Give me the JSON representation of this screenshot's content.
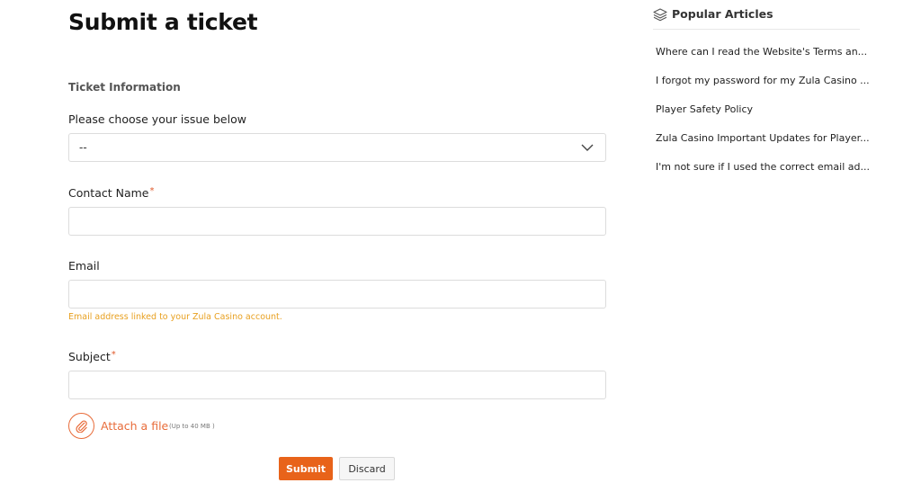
{
  "page": {
    "title": "Submit a ticket"
  },
  "form": {
    "section_title": "Ticket Information",
    "issue_label": "Please choose your issue below",
    "issue_value": "--",
    "contact_label": "Contact Name",
    "required_mark": "*",
    "email_label": "Email",
    "email_hint": "Email address linked to your Zula Casino account.",
    "subject_label": "Subject",
    "attach_label": "Attach a file",
    "attach_limit": "(Up to 40 MB )",
    "submit_label": "Submit",
    "discard_label": "Discard"
  },
  "sidebar": {
    "title": "Popular Articles",
    "articles": [
      "Where can I read the Website's Terms an...",
      "I forgot my password for my Zula Casino ...",
      "Player Safety Policy",
      "Zula Casino Important Updates for Player...",
      "I'm not sure if I used the correct email ad..."
    ]
  },
  "colors": {
    "accent": "#e8631a",
    "hint": "#e8a020",
    "required": "#e05a2b"
  },
  "icons": {
    "dropdown": "chevron-down-icon",
    "attach": "paperclip-icon",
    "popular": "layers-icon"
  }
}
